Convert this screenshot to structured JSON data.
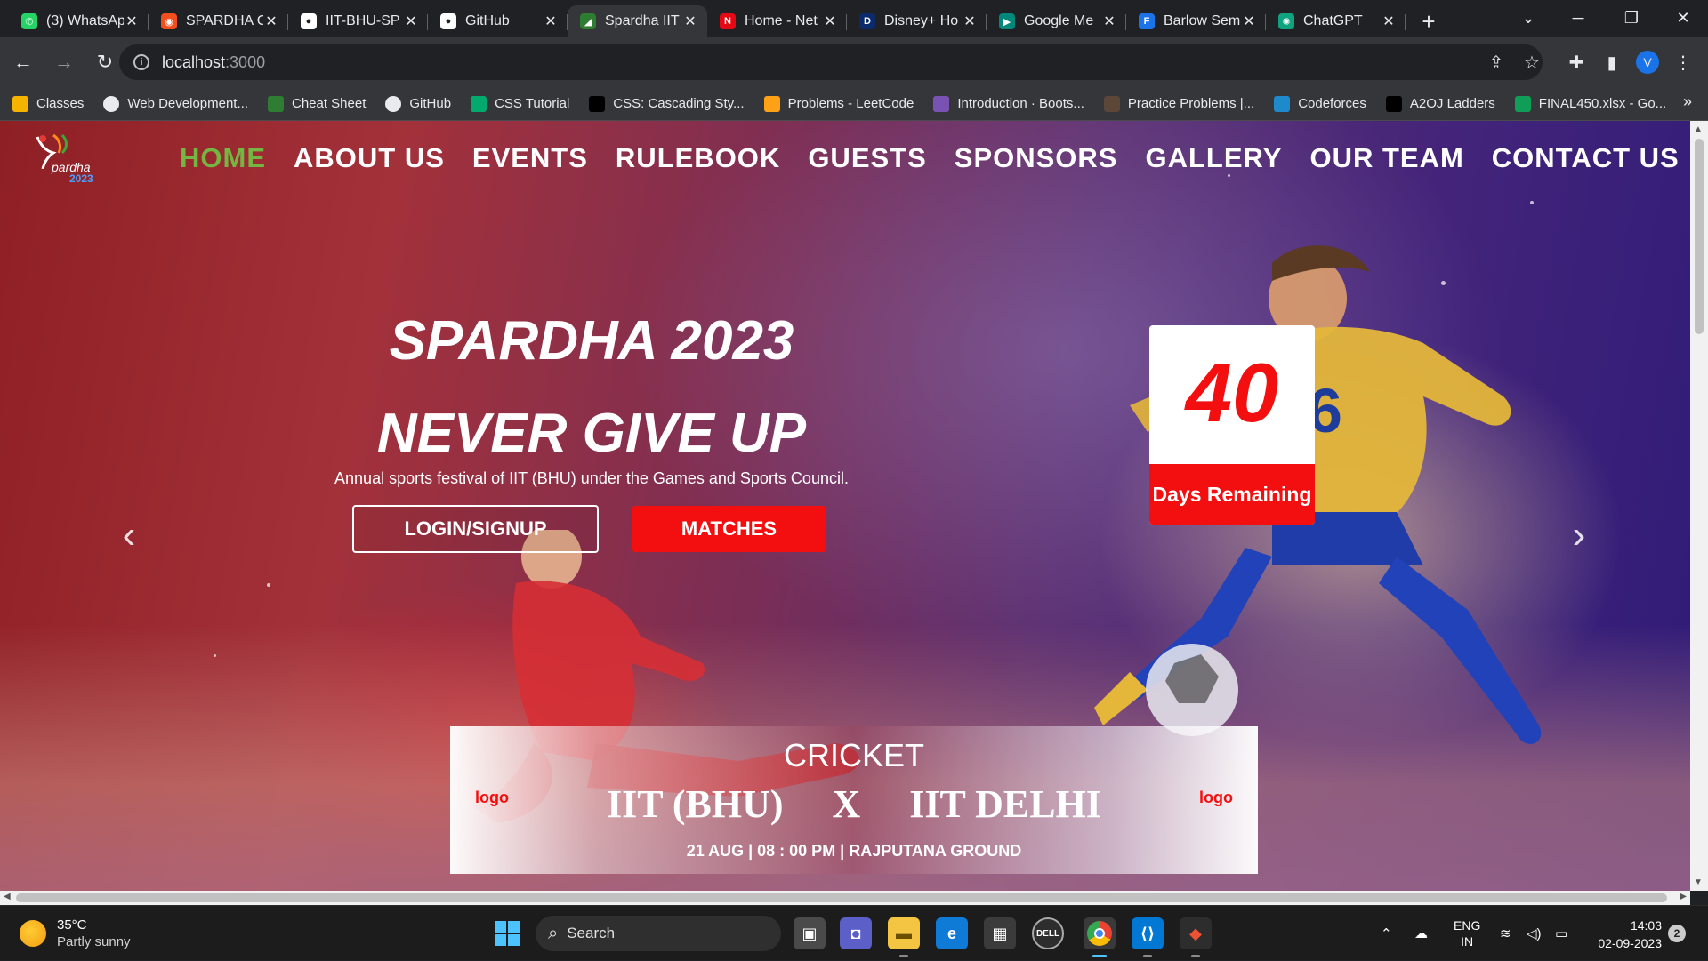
{
  "browser": {
    "tabs": [
      {
        "title": "(3) WhatsApp",
        "icon": "whatsapp-icon",
        "color": "#25d366",
        "glyph": "✆"
      },
      {
        "title": "SPARDHA C",
        "icon": "figma-icon",
        "color": "#f24e1e",
        "glyph": "◉"
      },
      {
        "title": "IIT-BHU-SP",
        "icon": "github-icon",
        "color": "#ffffff",
        "glyph": "●"
      },
      {
        "title": "GitHub",
        "icon": "github-icon",
        "color": "#ffffff",
        "glyph": "●"
      },
      {
        "title": "Spardha IIT",
        "icon": "spardha-icon",
        "color": "#2e7d32",
        "glyph": "◢",
        "active": true
      },
      {
        "title": "Home - Net",
        "icon": "netflix-icon",
        "color": "#e50914",
        "glyph": "N"
      },
      {
        "title": "Disney+ Ho",
        "icon": "disney-icon",
        "color": "#0b2a6b",
        "glyph": "D"
      },
      {
        "title": "Google Me",
        "icon": "google-meet-icon",
        "color": "#00897b",
        "glyph": "▶"
      },
      {
        "title": "Barlow Sem",
        "icon": "google-fonts-icon",
        "color": "#1a73e8",
        "glyph": "F"
      },
      {
        "title": "ChatGPT",
        "icon": "chatgpt-icon",
        "color": "#10a37f",
        "glyph": "✺"
      }
    ],
    "url": {
      "host": "localhost",
      "port": ":3000"
    },
    "bookmarks": [
      {
        "label": "Classes",
        "icon": "classroom-icon",
        "color": "#f4b400"
      },
      {
        "label": "Web Development...",
        "icon": "web-icon",
        "color": "#ffffff"
      },
      {
        "label": "Cheat Sheet",
        "icon": "cheat-sheet-icon",
        "color": "#2e7d32"
      },
      {
        "label": "GitHub",
        "icon": "github-icon",
        "color": "#ffffff"
      },
      {
        "label": "CSS Tutorial",
        "icon": "w3schools-icon",
        "color": "#04aa6d"
      },
      {
        "label": "CSS: Cascading Sty...",
        "icon": "mdn-icon",
        "color": "#000000"
      },
      {
        "label": "Problems - LeetCode",
        "icon": "leetcode-icon",
        "color": "#ffa116"
      },
      {
        "label": "Introduction · Boots...",
        "icon": "bootstrap-icon",
        "color": "#7952b3"
      },
      {
        "label": "Practice Problems |...",
        "icon": "codechef-icon",
        "color": "#5b4638"
      },
      {
        "label": "Codeforces",
        "icon": "codeforces-icon",
        "color": "#1f8acb"
      },
      {
        "label": "A2OJ Ladders",
        "icon": "a2oj-icon",
        "color": "#000000"
      },
      {
        "label": "FINAL450.xlsx - Go...",
        "icon": "google-drive-icon",
        "color": "#0f9d58"
      }
    ],
    "profile_initial": "V"
  },
  "site": {
    "logo": {
      "text": "pardha",
      "year": "2023"
    },
    "nav": [
      "HOME",
      "ABOUT US",
      "EVENTS",
      "RULEBOOK",
      "GUESTS",
      "SPONSORS",
      "GALLERY",
      "OUR TEAM",
      "CONTACT US"
    ],
    "active_nav": "HOME",
    "headline_1": "SPARDHA 2023",
    "headline_2": "NEVER GIVE UP",
    "tagline": "Annual sports festival of IIT (BHU) under the Games and Sports Council.",
    "login_button": "LOGIN/SIGNUP",
    "matches_button": "MATCHES",
    "countdown": {
      "number": "40",
      "label": "Days Remaining"
    },
    "accent_color": "#f30f0f",
    "nav_active_color": "#73b742",
    "match": {
      "sport": "CRICKET",
      "team_a": "IIT (BHU)",
      "versus": "X",
      "team_b": "IIT DELHI",
      "logo_placeholder": "logo",
      "info": "21 AUG | 08 : 00 PM | RAJPUTANA GROUND"
    }
  },
  "taskbar": {
    "weather": {
      "temp": "35°C",
      "condition": "Partly sunny"
    },
    "search_placeholder": "Search",
    "language": {
      "line1": "ENG",
      "line2": "IN"
    },
    "time": "14:03",
    "date": "02-09-2023",
    "notifications": "2"
  }
}
